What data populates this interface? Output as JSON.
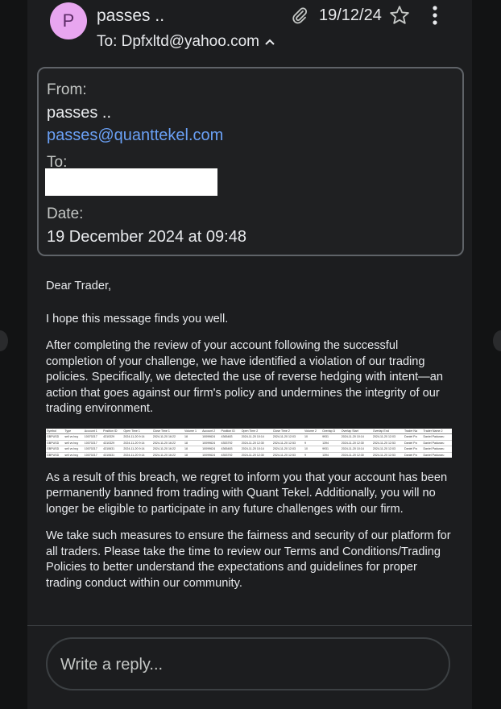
{
  "header": {
    "avatar_letter": "P",
    "sender": "passes ..",
    "to_line": "To: Dpfxltd@yahoo.com",
    "date": "19/12/24"
  },
  "details": {
    "from_label": "From:",
    "from_name": "passes ..",
    "from_email": "passes@quanttekel.com",
    "to_label": "To:",
    "date_label": "Date:",
    "date_value": "19 December 2024 at 09:48"
  },
  "body": {
    "greeting": "Dear Trader,",
    "p1": "I hope this message finds you well.",
    "p2": "After completing the review of your account following the successful completion of your challenge, we have identified a violation of our trading policies. Specifically, we detected the use of reverse hedging with intent—an action that goes against our firm's policy and undermines the integrity of our trading environment.",
    "p3": "As a result of this breach, we regret to inform you that your account has been permanently banned from trading with Quant Tekel. Additionally, you will no longer be eligible to participate in any future challenges with our firm.",
    "p4": "We take such measures to ensure the fairness and security of our platform for all traders. Please take the time to review our Terms and Conditions/Trading Policies to better understand the expectations and guidelines for proper trading conduct within our community."
  },
  "table": {
    "headers": [
      "Symbol",
      "Type",
      "Account 1",
      "Position ID",
      "Open Time 1",
      "Close Time 1",
      "Volume 1",
      "Account 2",
      "Position ID",
      "Open Time 2",
      "Close Time 2",
      "Volume 2",
      "Overlap D",
      "Overlap Start",
      "Overlap End",
      "Trader Na",
      "Trader Name 2"
    ],
    "rows": [
      [
        "GBPUSD",
        "sell vs buy",
        "10070217",
        "4310329",
        "2024-11-20 9:14",
        "2024-11-20 16:22",
        "18",
        "10099624",
        "4365483",
        "2024-11-20 10:14",
        "2024-11-20 12:03",
        "10",
        "9931",
        "2024-11-20 10:14",
        "2024-11-20 12:03",
        "Daniel Pa",
        "Daniel Paduraru"
      ],
      [
        "GBPUSD",
        "sell vs buy",
        "10070217",
        "4310329",
        "2024-11-20 9:14",
        "2024-11-20 16:22",
        "18",
        "10099624",
        "4353792",
        "2024-11-20 12:30",
        "2024-11-20 12:53",
        "9",
        "1394",
        "2024-11-20 12:30",
        "2024-11-20 12:53",
        "Daniel Pa",
        "Daniel Paduraru"
      ],
      [
        "GBPUSD",
        "sell vs buy",
        "10070217",
        "4310631",
        "2024-11-20 9:14",
        "2024-11-20 16:22",
        "18",
        "10099624",
        "4365483",
        "2024-11-20 10:14",
        "2024-11-20 12:03",
        "10",
        "9931",
        "2024-11-20 10:14",
        "2024-11-20 12:03",
        "Daniel Pa",
        "Daniel Paduraru"
      ],
      [
        "GBPUSD",
        "sell vs buy",
        "10070217",
        "4310631",
        "2024-11-20 9:14",
        "2024-11-20 16:22",
        "18",
        "10099624",
        "4353792",
        "2024-11-20 12:30",
        "2024-11-20 12:53",
        "9",
        "1394",
        "2024-11-20 12:30",
        "2024-11-20 12:53",
        "Daniel Pa",
        "Daniel Paduraru"
      ]
    ]
  },
  "reply": {
    "placeholder": "Write a reply..."
  },
  "icons": {
    "attachment": "paperclip-icon",
    "star": "star-icon",
    "more": "more-vert-icon",
    "expand": "chevron-up-icon"
  }
}
